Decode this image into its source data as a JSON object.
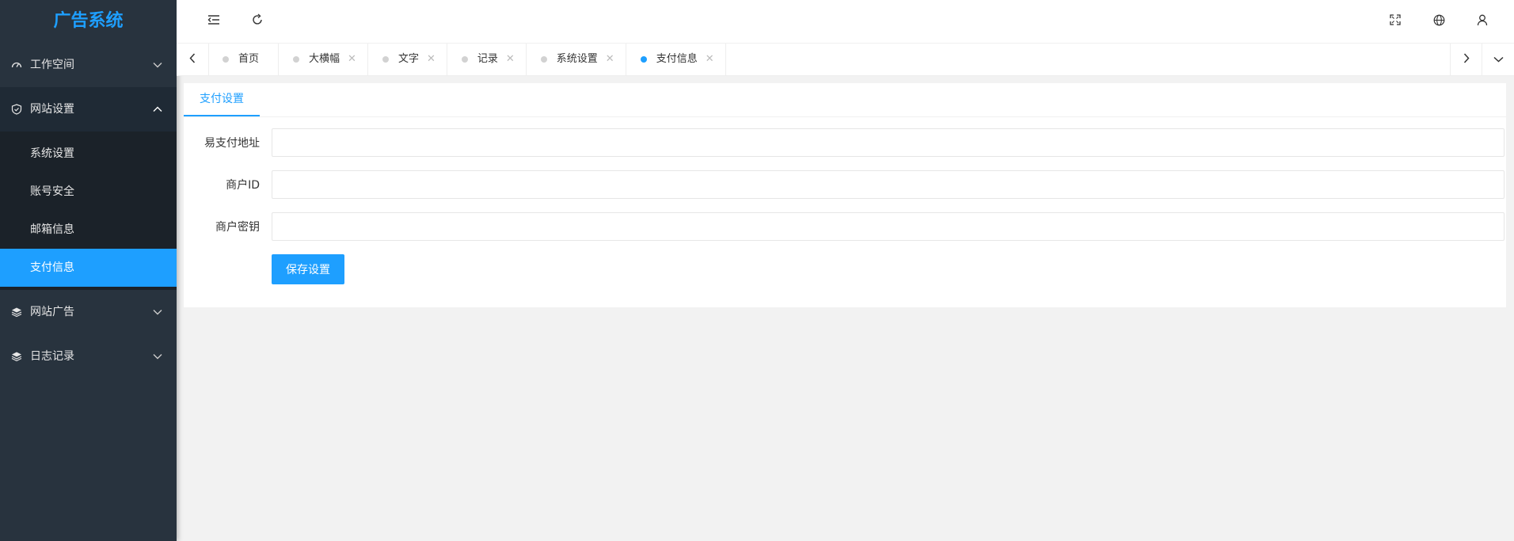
{
  "sidebar": {
    "logo": "广告系统",
    "menu": {
      "workspace": "工作空间",
      "website_settings": "网站设置",
      "website_ads": "网站广告",
      "logs": "日志记录"
    },
    "submenu": [
      "系统设置",
      "账号安全",
      "邮箱信息",
      "支付信息"
    ],
    "active_submenu": "支付信息"
  },
  "header": {
    "icons": [
      "menu-fold-icon",
      "refresh-icon",
      "fullscreen-icon",
      "globe-icon",
      "user-icon",
      "more-icon"
    ]
  },
  "tabs": {
    "items": [
      "首页",
      "大横幅",
      "文字",
      "记录",
      "系统设置",
      "支付信息"
    ],
    "active": "支付信息"
  },
  "content": {
    "tab_label": "支付设置",
    "fields": [
      {
        "label": "易支付地址",
        "value": ""
      },
      {
        "label": "商户ID",
        "value": ""
      },
      {
        "label": "商户密钥",
        "value": ""
      }
    ],
    "save_label": "保存设置"
  },
  "colors": {
    "accent": "#1e9fff",
    "sidebar_bg": "#28333e",
    "submenu_bg": "#1b2229"
  }
}
